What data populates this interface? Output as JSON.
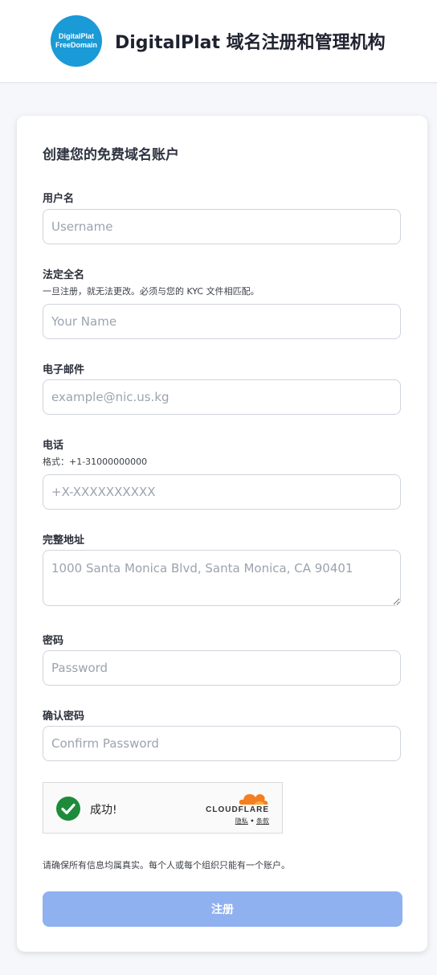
{
  "header": {
    "logo_line1": "DigitalPlat",
    "logo_line2": "FreeDomain",
    "title": "DigitalPlat 域名注册和管理机构"
  },
  "form": {
    "title": "创建您的免费域名账户",
    "username": {
      "label": "用户名",
      "placeholder": "Username"
    },
    "legal_name": {
      "label": "法定全名",
      "hint": "一旦注册，就无法更改。必须与您的 KYC 文件相匹配。",
      "placeholder": "Your Name"
    },
    "email": {
      "label": "电子邮件",
      "placeholder": "example@nic.us.kg"
    },
    "phone": {
      "label": "电话",
      "hint": "格式：+1-31000000000",
      "placeholder": "+X-XXXXXXXXXX"
    },
    "address": {
      "label": "完整地址",
      "placeholder": "1000 Santa Monica Blvd, Santa Monica, CA 90401"
    },
    "password": {
      "label": "密码",
      "placeholder": "Password"
    },
    "confirm_password": {
      "label": "确认密码",
      "placeholder": "Confirm Password"
    },
    "captcha": {
      "status": "成功!",
      "brand": "CLOUDFLARE",
      "privacy": "隐私",
      "separator": "•",
      "terms": "条款"
    },
    "notice": "请确保所有信息均属真实。每个人或每个组织只能有一个账户。",
    "submit_label": "注册"
  },
  "colors": {
    "brand_blue": "#1a9ad6",
    "button": "#8fb1f0",
    "success": "#1d8b3a",
    "cloudflare_orange": "#f38020"
  }
}
